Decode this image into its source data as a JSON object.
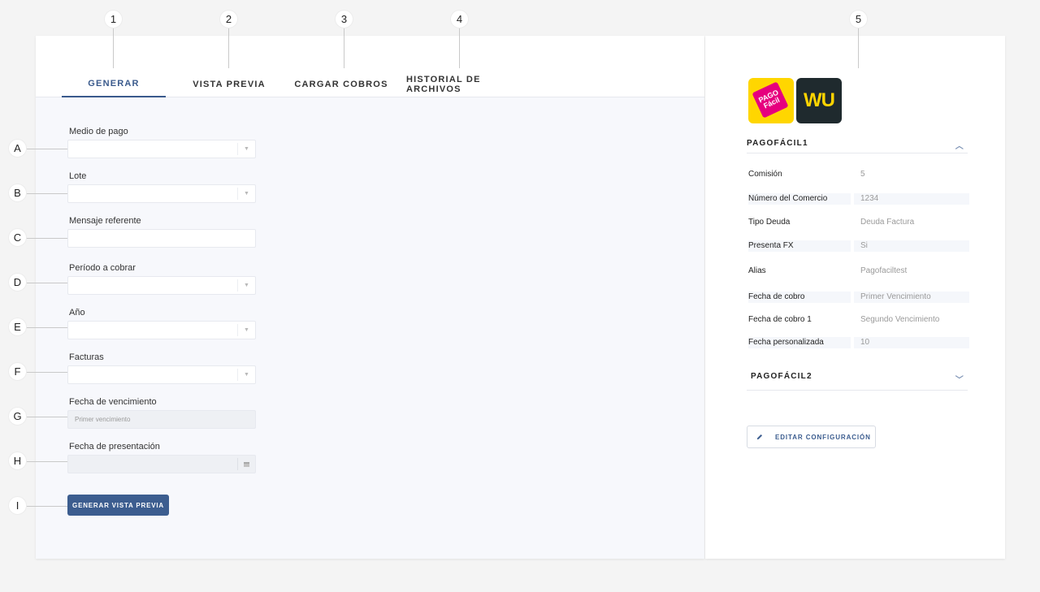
{
  "markers": {
    "top": [
      "1",
      "2",
      "3",
      "4",
      "5"
    ],
    "side": [
      "A",
      "B",
      "C",
      "D",
      "E",
      "F",
      "G",
      "H",
      "I"
    ]
  },
  "tabs": [
    {
      "label": "GENERAR"
    },
    {
      "label": "VISTA PREVIA"
    },
    {
      "label": "CARGAR COBROS"
    },
    {
      "label": "HISTORIAL DE ARCHIVOS"
    }
  ],
  "form": {
    "medio_de_pago": {
      "label": "Medio de pago",
      "value": ""
    },
    "lote": {
      "label": "Lote",
      "value": ""
    },
    "mensaje_referente": {
      "label": "Mensaje referente",
      "value": ""
    },
    "periodo_a_cobrar": {
      "label": "Período a cobrar",
      "value": ""
    },
    "anio": {
      "label": "Año",
      "value": ""
    },
    "facturas": {
      "label": "Facturas",
      "value": ""
    },
    "fecha_vencimiento": {
      "label": "Fecha de vencimiento",
      "placeholder": "Primer vencimiento"
    },
    "fecha_presentacion": {
      "label": "Fecha de presentación",
      "value": ""
    },
    "submit_label": "GENERAR VISTA PREVIA"
  },
  "sidebar": {
    "logos": [
      {
        "name": "pagofacil-logo",
        "text": "PAGO Fácil"
      },
      {
        "name": "western-union-logo",
        "text": "WU"
      }
    ],
    "sections": [
      {
        "title": "PAGOFÁCIL1",
        "expanded": true,
        "rows": [
          {
            "label": "Comisión",
            "value": "5"
          },
          {
            "label": "Número del Comercio",
            "value": "1234"
          },
          {
            "label": "Tipo Deuda",
            "value": "Deuda Factura"
          },
          {
            "label": "Presenta FX",
            "value": "Si"
          },
          {
            "label": "Alias",
            "value": "Pagofaciltest"
          },
          {
            "label": "Fecha de cobro",
            "value": "Primer Vencimiento"
          },
          {
            "label": "Fecha de cobro 1",
            "value": "Segundo Vencimiento"
          },
          {
            "label": "Fecha personalizada",
            "value": "10"
          }
        ]
      },
      {
        "title": "PAGOFÁCIL2",
        "expanded": false
      }
    ],
    "edit_button_label": "EDITAR CONFIGURACIÓN"
  },
  "colors": {
    "accent": "#3c5d8f",
    "pagofacil_yellow": "#ffd600",
    "pagofacil_pink": "#e6007e",
    "wu_yellow": "#ffd400"
  }
}
